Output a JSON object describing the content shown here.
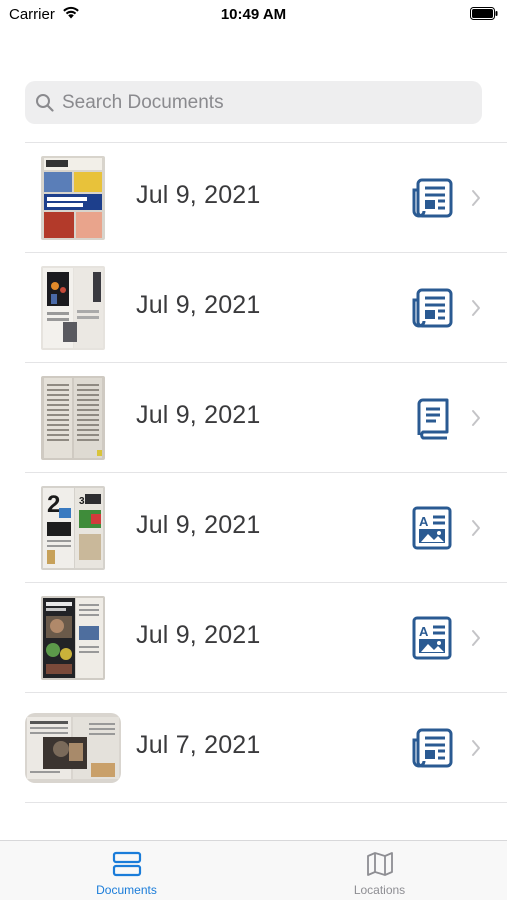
{
  "status_bar": {
    "carrier": "Carrier",
    "time": "10:49 AM"
  },
  "search": {
    "placeholder": "Search Documents"
  },
  "documents": [
    {
      "date": "Jul 9, 2021",
      "type_icon": "newspaper-icon"
    },
    {
      "date": "Jul 9, 2021",
      "type_icon": "newspaper-icon"
    },
    {
      "date": "Jul 9, 2021",
      "type_icon": "book-icon"
    },
    {
      "date": "Jul 9, 2021",
      "type_icon": "magazine-icon"
    },
    {
      "date": "Jul 9, 2021",
      "type_icon": "magazine-icon"
    },
    {
      "date": "Jul 7, 2021",
      "type_icon": "newspaper-icon"
    }
  ],
  "tab_bar": {
    "documents_label": "Documents",
    "locations_label": "Locations"
  },
  "colors": {
    "icon_blue": "#2a5a92",
    "tab_active": "#1a7cd9",
    "tab_inactive": "#8e8e93"
  }
}
